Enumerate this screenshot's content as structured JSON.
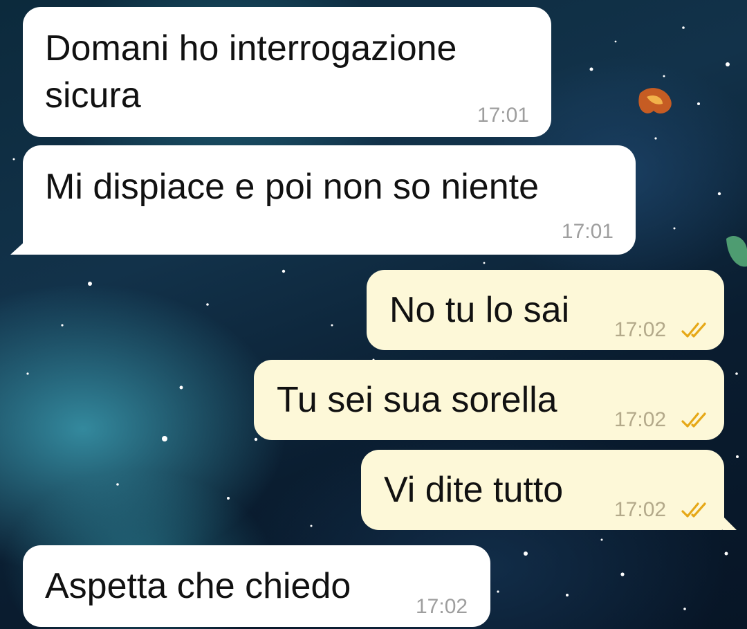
{
  "messages": [
    {
      "direction": "incoming",
      "lines": [
        "Domani ho interrogazione",
        "sicura"
      ],
      "time": "17:01"
    },
    {
      "direction": "incoming",
      "lines": [
        "Mi dispiace e poi non so niente"
      ],
      "time": "17:01"
    },
    {
      "direction": "outgoing",
      "lines": [
        "No tu lo sai"
      ],
      "time": "17:02",
      "status": "read"
    },
    {
      "direction": "outgoing",
      "lines": [
        "Tu sei sua sorella"
      ],
      "time": "17:02",
      "status": "read"
    },
    {
      "direction": "outgoing",
      "lines": [
        "Vi dite tutto"
      ],
      "time": "17:02",
      "status": "read"
    },
    {
      "direction": "incoming",
      "lines": [
        "Aspetta che chiedo"
      ],
      "time": "17:02"
    }
  ],
  "colors": {
    "incoming_bubble": "#ffffff",
    "outgoing_bubble": "#fdf8d8",
    "read_check": "#e6a817",
    "wallpaper": "#0c2a3c"
  },
  "icons": {
    "read_receipt": "double-check-icon"
  }
}
